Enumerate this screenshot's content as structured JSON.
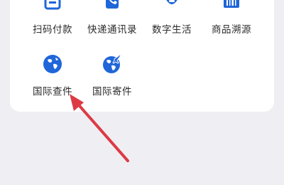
{
  "services": {
    "row1": [
      {
        "label": "扫码付款",
        "icon": "scan-pay-icon"
      },
      {
        "label": "快递通讯录",
        "icon": "express-contacts-icon"
      },
      {
        "label": "数字生活",
        "icon": "digital-life-icon"
      },
      {
        "label": "商品溯源",
        "icon": "barcode-trace-icon"
      }
    ],
    "row2": [
      {
        "label": "国际查件",
        "icon": "globe-icon"
      },
      {
        "label": "国际寄件",
        "icon": "globe-plane-icon"
      }
    ]
  },
  "colors": {
    "accent": "#1f66d9",
    "background": "#efeff3",
    "card": "#ffffff",
    "annotation_arrow": "#dc3b46"
  }
}
